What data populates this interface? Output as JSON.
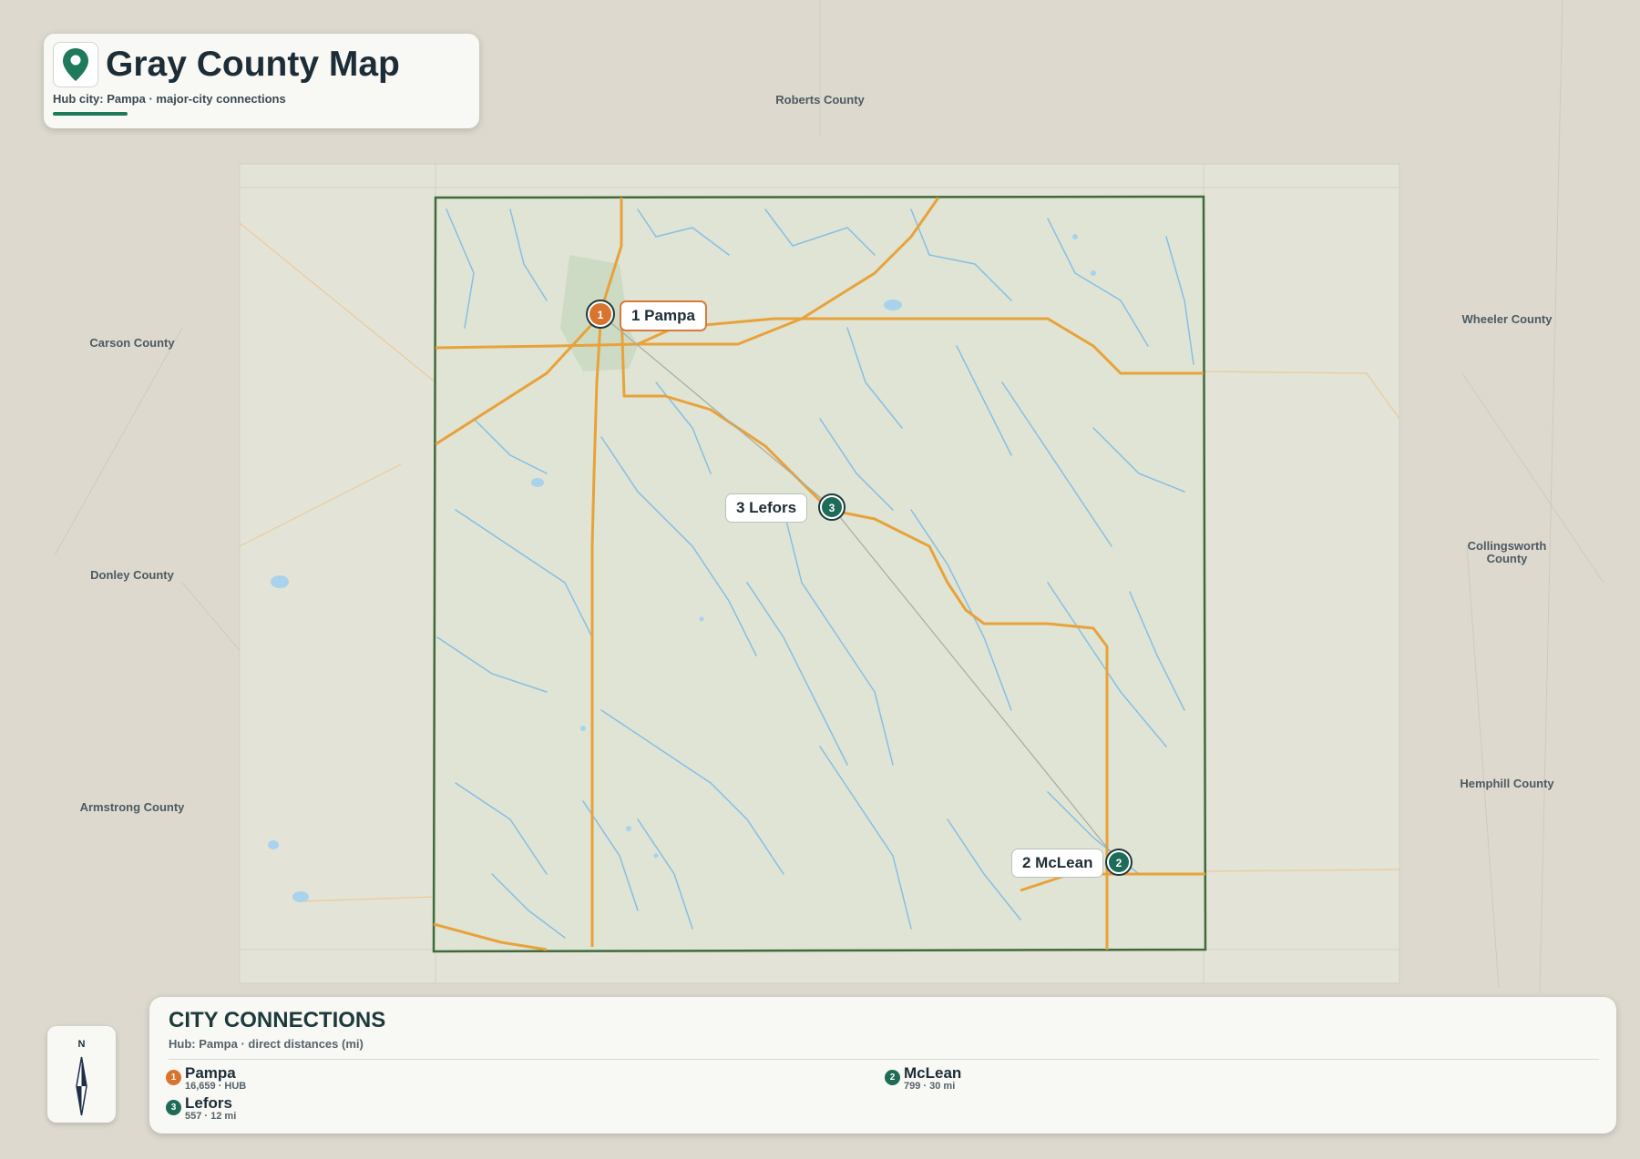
{
  "title": {
    "heading": "Gray County Map",
    "subtitle": "Hub city: Pampa · major-city connections",
    "icon": "map-pin-icon",
    "accent": "#1e7a5a"
  },
  "neighbors": {
    "north": "Roberts County",
    "west_top": "Carson County",
    "west_middle": "Donley County",
    "west_bottom": "Armstrong County",
    "east_top": "Wheeler County",
    "east_middle": "Collingsworth County",
    "east_bottom": "Hemphill County"
  },
  "cities": {
    "pampa": {
      "label": "1 Pampa",
      "rank": "1",
      "role": "hub"
    },
    "lefors": {
      "label": "3 Lefors",
      "rank": "3",
      "role": "satellite"
    },
    "mclean": {
      "label": "2 McLean",
      "rank": "2",
      "role": "satellite"
    }
  },
  "compass": {
    "label": "N",
    "icon": "compass-needle-icon"
  },
  "connections": {
    "title": "CITY CONNECTIONS",
    "subtitle": "Hub: Pampa · direct distances (mi)",
    "items": [
      {
        "rank": "1",
        "name": "Pampa",
        "meta": "16,659 · HUB"
      },
      {
        "rank": "2",
        "name": "McLean",
        "meta": "799 · 30 mi"
      },
      {
        "rank": "3",
        "name": "Lefors",
        "meta": "557 · 12 mi"
      }
    ]
  },
  "colors": {
    "hub": "#d9742f",
    "satellite": "#1e6b58",
    "county_border": "#3f6a3a",
    "road": "#e7a23b",
    "water": "#6fb4e0"
  }
}
